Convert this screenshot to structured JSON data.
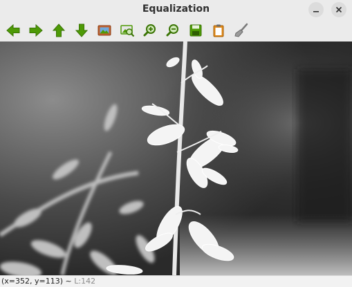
{
  "window": {
    "title": "Equalization"
  },
  "window_controls": {
    "minimize_icon": "minimize-icon",
    "close_icon": "close-icon"
  },
  "toolbar": {
    "buttons": [
      {
        "name": "back",
        "icon": "arrow-left-icon",
        "color": "#4e9a06"
      },
      {
        "name": "forward",
        "icon": "arrow-right-icon",
        "color": "#4e9a06"
      },
      {
        "name": "up",
        "icon": "arrow-up-icon",
        "color": "#4e9a06"
      },
      {
        "name": "down",
        "icon": "arrow-down-icon",
        "color": "#4e9a06"
      },
      {
        "name": "image",
        "icon": "picture-icon",
        "color": "#c4622d"
      },
      {
        "name": "image-zoom",
        "icon": "picture-zoom-icon",
        "color": "#4e9a06"
      },
      {
        "name": "zoom-in",
        "icon": "zoom-in-icon",
        "color": "#4e9a06"
      },
      {
        "name": "zoom-out",
        "icon": "zoom-out-icon",
        "color": "#4e9a06"
      },
      {
        "name": "save",
        "icon": "floppy-disk-icon",
        "color": "#4e9a06"
      },
      {
        "name": "copy",
        "icon": "clipboard-icon",
        "color": "#e08a1a"
      },
      {
        "name": "clear",
        "icon": "brush-icon",
        "color": "#8c8c8c"
      }
    ]
  },
  "status": {
    "coords": "(x=352, y=113) ~ ",
    "luminance": "L:142"
  }
}
